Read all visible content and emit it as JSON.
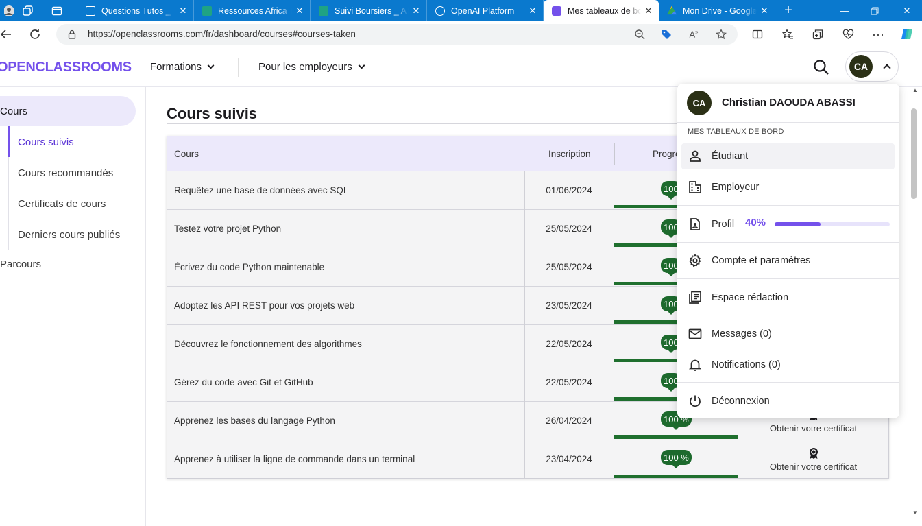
{
  "browser": {
    "tabs": [
      {
        "label": "Questions Tutos _ Ti",
        "icon": "doc-icon"
      },
      {
        "label": "Ressources Africa Te",
        "icon": "sheet-icon"
      },
      {
        "label": "Suivi Boursiers _ AT",
        "icon": "sheet-icon"
      },
      {
        "label": "OpenAI Platform",
        "icon": "openai-icon"
      },
      {
        "label": "Mes tableaux de bo",
        "icon": "openclassrooms-icon"
      },
      {
        "label": "Mon Drive - Google",
        "icon": "drive-icon"
      }
    ],
    "url": "https://openclassrooms.com/fr/dashboard/courses#courses-taken",
    "accent": "#0a79ce"
  },
  "header": {
    "logo": "OPENCLASSROOMS",
    "nav": [
      "Formations",
      "Pour les employeurs"
    ],
    "avatar_initials": "CA"
  },
  "sidebar": {
    "section": "Cours",
    "items": [
      "Cours suivis",
      "Cours recommandés",
      "Certificats de cours",
      "Derniers cours publiés"
    ],
    "parcours": "Parcours"
  },
  "main": {
    "title": "Cours suivis",
    "columns": [
      "Cours",
      "Inscription",
      "Progre"
    ],
    "rows": [
      {
        "course": "Requêtez une base de données avec SQL",
        "date": "01/06/2024",
        "progress": "100",
        "certificate": ""
      },
      {
        "course": "Testez votre projet Python",
        "date": "25/05/2024",
        "progress": "100",
        "certificate": ""
      },
      {
        "course": "Écrivez du code Python maintenable",
        "date": "25/05/2024",
        "progress": "100",
        "certificate": ""
      },
      {
        "course": "Adoptez les API REST pour vos projets web",
        "date": "23/05/2024",
        "progress": "100",
        "certificate": ""
      },
      {
        "course": "Découvrez le fonctionnement des algorithmes",
        "date": "22/05/2024",
        "progress": "100",
        "certificate": ""
      },
      {
        "course": "Gérez du code avec Git et GitHub",
        "date": "22/05/2024",
        "progress": "100",
        "certificate": ""
      },
      {
        "course": "Apprenez les bases du langage Python",
        "date": "26/04/2024",
        "progress": "100 %",
        "certificate": "Obtenir votre certificat"
      },
      {
        "course": "Apprenez à utiliser la ligne de commande dans un terminal",
        "date": "23/04/2024",
        "progress": "100 %",
        "certificate": "Obtenir votre certificat"
      }
    ]
  },
  "dropdown": {
    "initials": "CA",
    "name": "Christian DAOUDA ABASSI",
    "caption": "MES TABLEAUX DE BORD",
    "student": "Étudiant",
    "employer": "Employeur",
    "profile": "Profil",
    "profile_pct_label": "40%",
    "profile_fraction": 0.4,
    "account": "Compte et paramètres",
    "writing": "Espace rédaction",
    "messages": "Messages (0)",
    "notifications": "Notifications (0)",
    "logout": "Déconnexion",
    "brand_color": "#7451eb"
  }
}
